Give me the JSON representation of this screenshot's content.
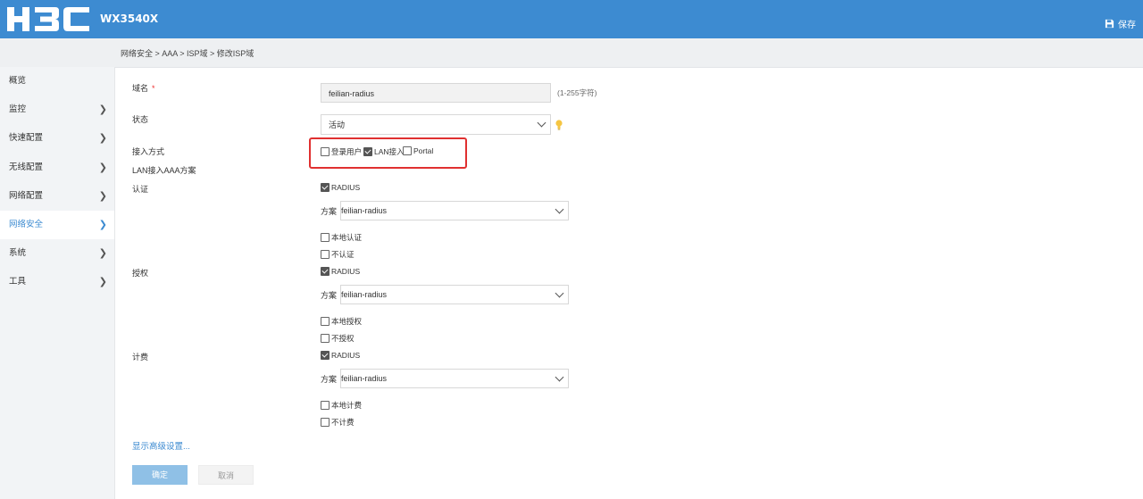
{
  "header": {
    "logo_text": "H3C",
    "model": "WX3540X",
    "save_label": "保存"
  },
  "breadcrumb": {
    "text": "网络安全 > AAA > ISP域 > 修改ISP域"
  },
  "sidebar": {
    "items": [
      {
        "label": "概览",
        "chevron": false
      },
      {
        "label": "监控",
        "chevron": true
      },
      {
        "label": "快速配置",
        "chevron": true
      },
      {
        "label": "无线配置",
        "chevron": true
      },
      {
        "label": "网络配置",
        "chevron": true
      },
      {
        "label": "网络安全",
        "chevron": true,
        "active": true
      },
      {
        "label": "系统",
        "chevron": true
      },
      {
        "label": "工具",
        "chevron": true
      }
    ]
  },
  "form": {
    "domain_label": "域名",
    "domain_required": "*",
    "domain_value": "feilian-radius",
    "domain_hint": "(1-255字符)",
    "state_label": "状态",
    "state_value": "活动",
    "access_label": "接入方式",
    "access_options": [
      {
        "label": "登录用户",
        "checked": false
      },
      {
        "label": "LAN接入",
        "checked": true
      },
      {
        "label": "Portal",
        "checked": false
      }
    ],
    "lan_aaa_label": "LAN接入AAA方案",
    "auth": {
      "label": "认证",
      "radius_label": "RADIUS",
      "radius_checked": true,
      "scheme_label": "方案",
      "scheme_value": "feilian-radius",
      "local_label": "本地认证",
      "local_checked": false,
      "none_label": "不认证",
      "none_checked": false
    },
    "authz": {
      "label": "授权",
      "radius_label": "RADIUS",
      "radius_checked": true,
      "scheme_label": "方案",
      "scheme_value": "feilian-radius",
      "local_label": "本地授权",
      "local_checked": false,
      "none_label": "不授权",
      "none_checked": false
    },
    "acct": {
      "label": "计费",
      "radius_label": "RADIUS",
      "radius_checked": true,
      "scheme_label": "方案",
      "scheme_value": "feilian-radius",
      "local_label": "本地计费",
      "local_checked": false,
      "none_label": "不计费",
      "none_checked": false
    },
    "advanced_link": "显示高级设置...",
    "ok_label": "确定",
    "cancel_label": "取消"
  },
  "colors": {
    "header_bg": "#3d8bd1",
    "highlight_box": "#e03030",
    "ok_button": "#8fc0e6"
  }
}
